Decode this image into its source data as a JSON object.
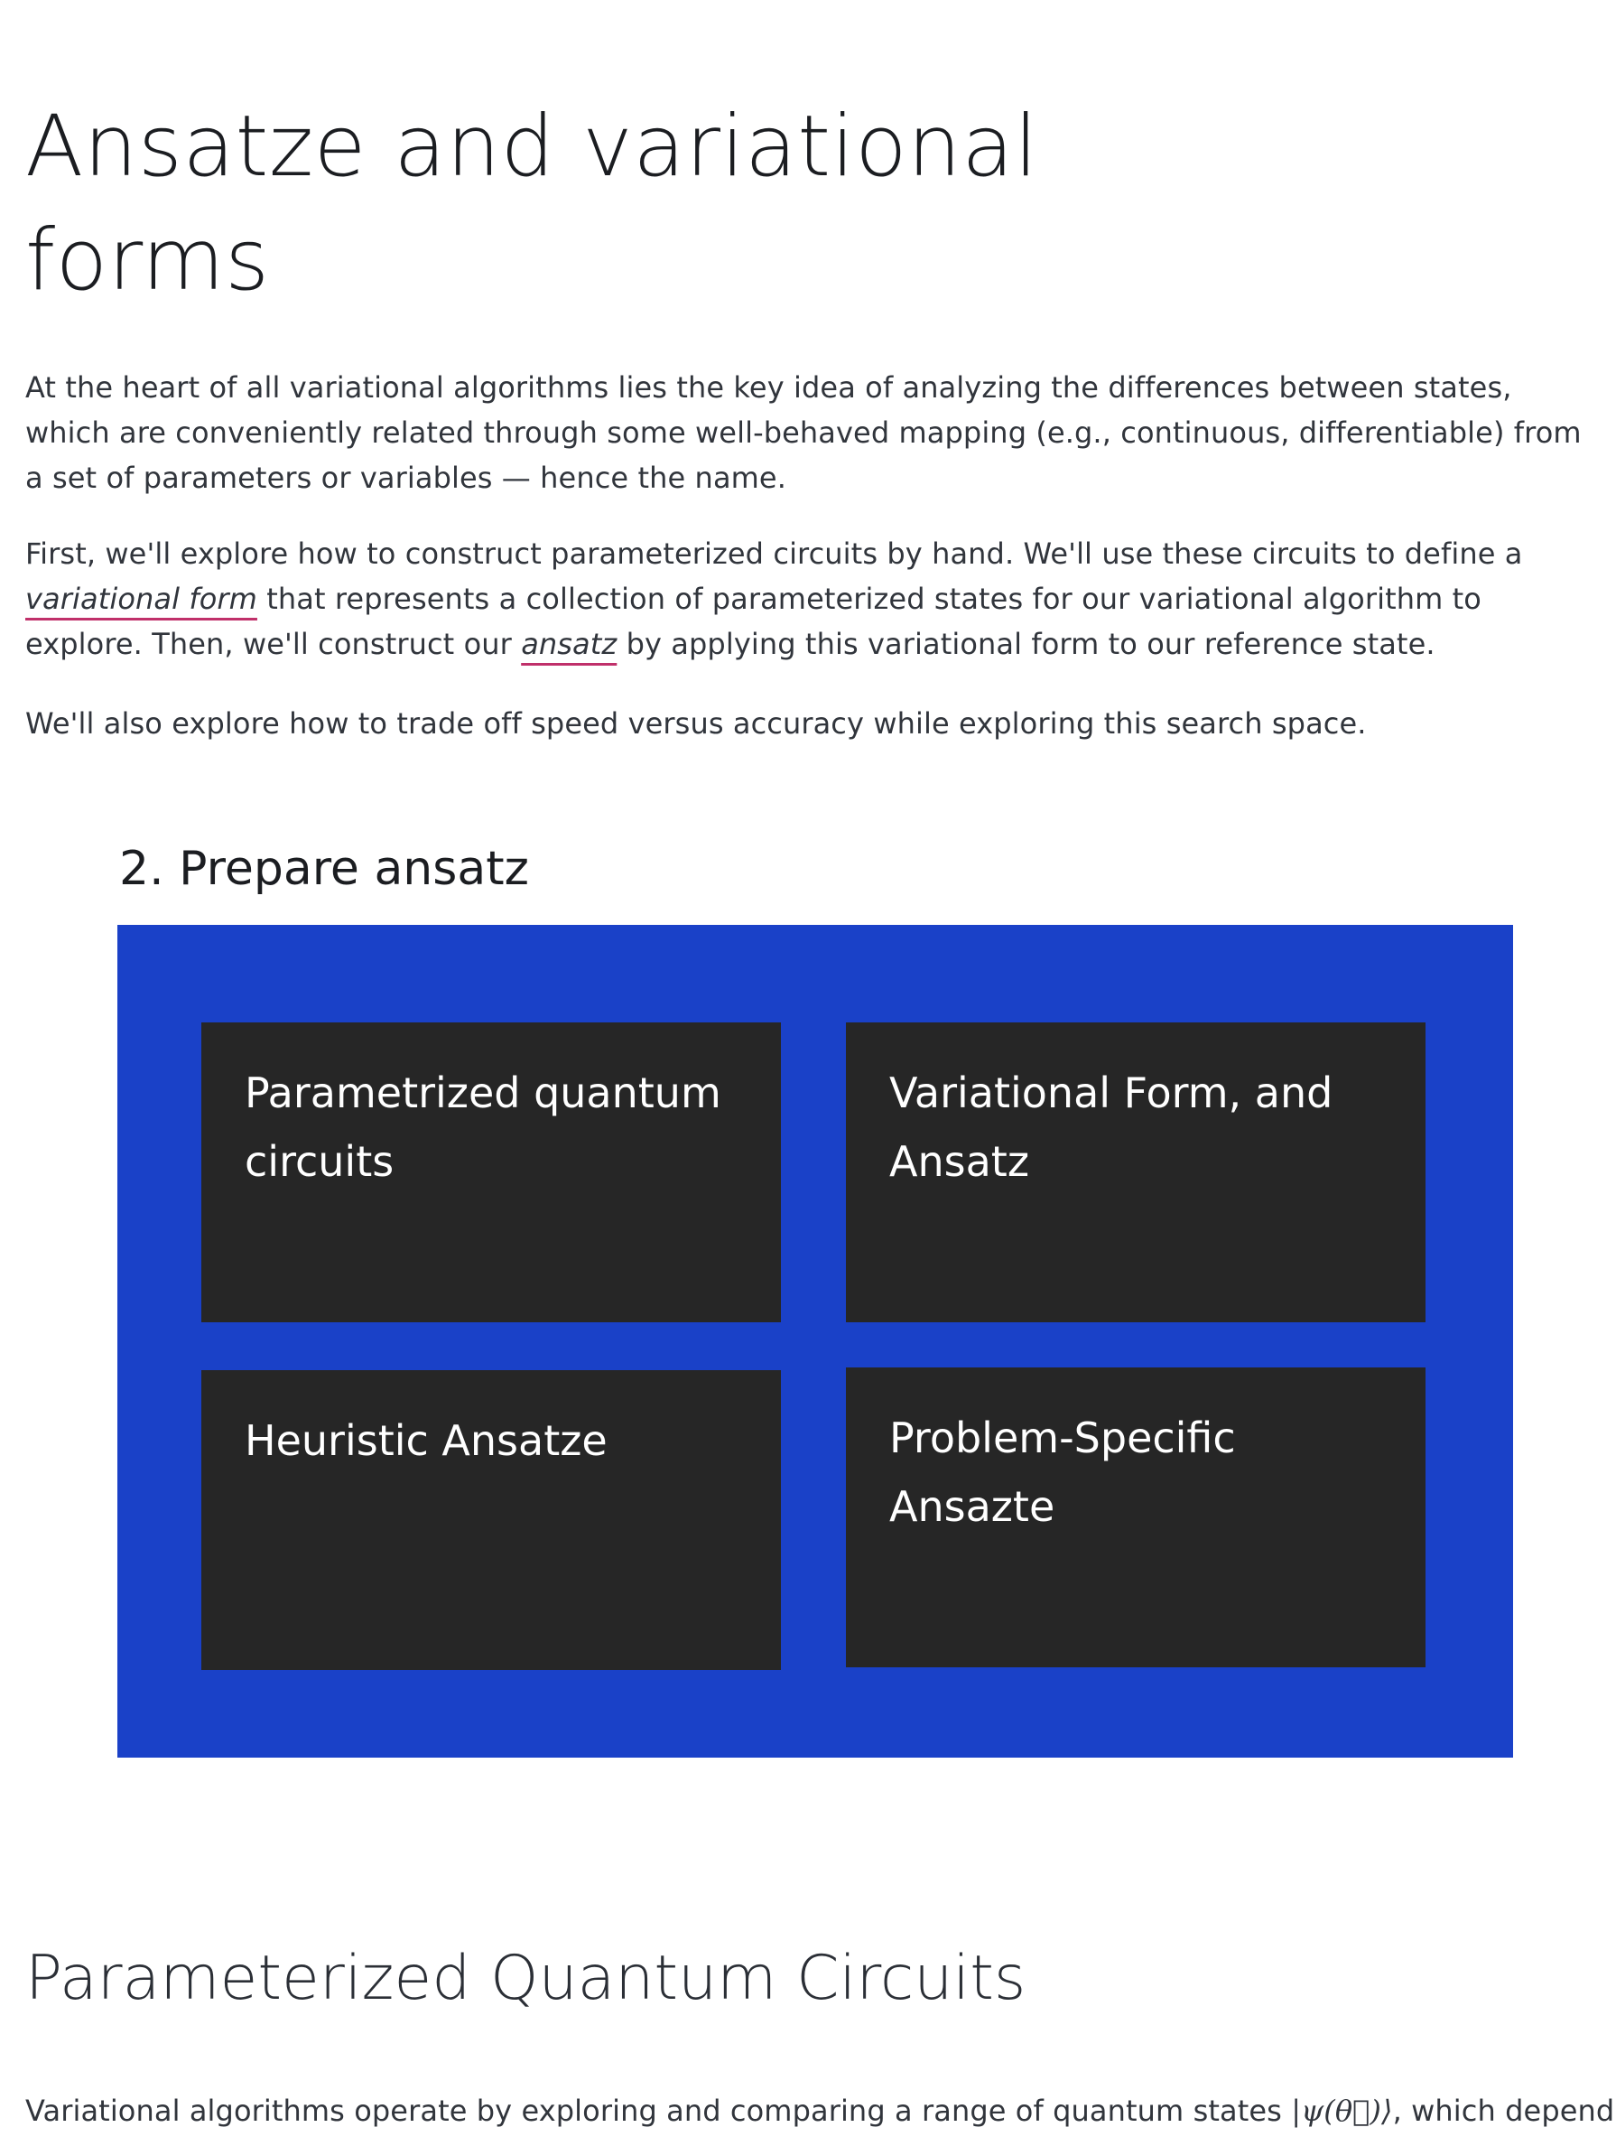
{
  "header": {
    "title": "Ansatze and variational forms"
  },
  "intro": {
    "paragraph1": "At the heart of all variational algorithms lies the key idea of analyzing the differences between states, which are conveniently related through some well-behaved mapping (e.g., continuous, differentiable) from a set of parameters or variables — hence the name.",
    "paragraph2": {
      "part1": "First, we'll explore how to construct parameterized circuits by hand. We'll use these circuits to define a ",
      "term1": "variational form",
      "part2": " that represents a collection of parameterized states for our variational algorithm to explore. Then, we'll construct our ",
      "term2": "ansatz",
      "part3": " by applying this variational form to our reference state."
    },
    "paragraph3": "We'll also explore how to trade off speed versus accuracy while exploring this search space."
  },
  "diagram": {
    "label": "2. Prepare ansatz",
    "cards": [
      {
        "label": "Parametrized quantum circuits"
      },
      {
        "label": "Variational Form, and Ansatz"
      },
      {
        "label": "Heuristic Ansatze"
      },
      {
        "label": "Problem-Specific Ansazte"
      }
    ],
    "colors": {
      "panel": "#1a41c8",
      "card": "#262626",
      "card_text": "#ffffff"
    }
  },
  "section": {
    "heading": "Parameterized Quantum Circuits",
    "paragraph_start": "Variational algorithms operate by exploring and comparing a range of quantum states ",
    "math": "|ψ(θ⃗)⟩",
    "paragraph_end": ", which depend on"
  },
  "colors": {
    "term_underline": "#c0306a",
    "text": "#31353c"
  }
}
